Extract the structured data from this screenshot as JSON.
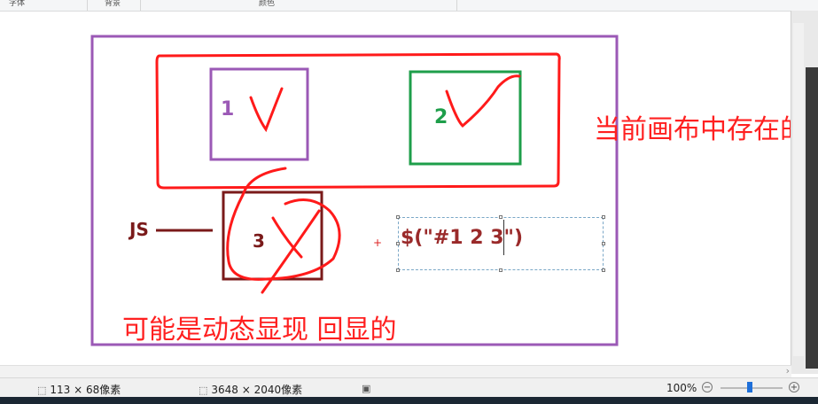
{
  "ribbon": {
    "groups": [
      "字体",
      "背景",
      "颜色"
    ]
  },
  "canvas": {
    "box1_label": "1",
    "box2_label": "2",
    "box3_label": "3",
    "js_label": "JS",
    "selector_text": "$(\"#1 2 3\")",
    "note_right": "当前画布中存在的",
    "note_bottom": "可能是动态显现 回显的",
    "colors": {
      "purple": "#9b59b6",
      "red": "#ff1a1a",
      "green": "#1e9e4a",
      "dark_red": "#7a1a1a"
    }
  },
  "statusbar": {
    "selection_size": "113 × 68像素",
    "image_size": "3648 × 2040像素",
    "zoom": "100%",
    "icons": [
      "selection-icon",
      "image-size-icon",
      "disk-icon",
      "zoom-out-icon",
      "zoom-in-icon"
    ]
  }
}
